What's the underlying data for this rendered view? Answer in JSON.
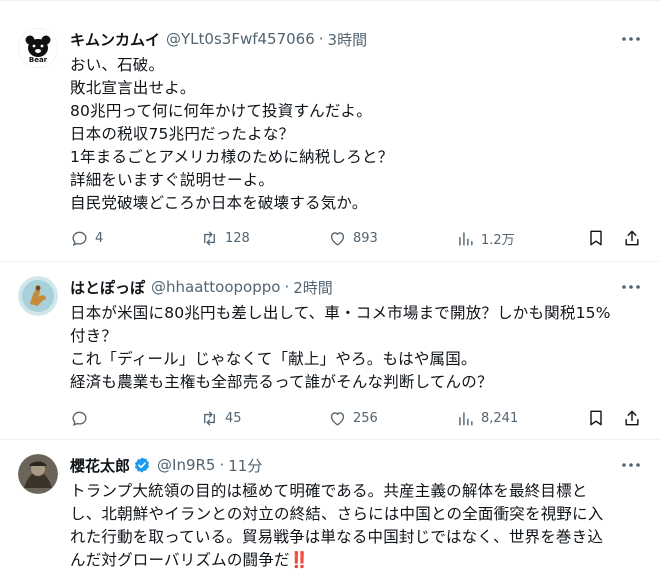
{
  "tweets": [
    {
      "name": "キムンカムイ",
      "handle": "@YLt0s3Fwf457066",
      "dot": "·",
      "time": "3時間",
      "avatar_text": "Bear",
      "text": "おい、石破。\n敗北宣言出せよ。\n80兆円って何に何年かけて投資すんだよ。\n日本の税収75兆円だったよな？\n1年まるごとアメリカ様のために納税しろと？\n詳細をいますぐ説明せーよ。\n自民党破壊どころか日本を破壊する気か。",
      "replies": "4",
      "retweets": "128",
      "likes": "893",
      "views": "1.2万"
    },
    {
      "name": "はとぽっぽ",
      "handle": "@hhaattoopoppo",
      "dot": "·",
      "time": "2時間",
      "text": "日本が米国に80兆円も差し出して、車・コメ市場まで開放？しかも関税15%\n付き？\nこれ「ディール」じゃなくて「献上」やろ。もはや属国。\n経済も農業も主権も全部売るって誰がそんな判断してんの？",
      "replies": "",
      "retweets": "45",
      "likes": "256",
      "views": "8,241"
    },
    {
      "name": "櫻花太郎",
      "handle": "@In9R5",
      "dot": "·",
      "time": "11分",
      "text": "トランプ大統領の目的は極めて明確である。共産主義の解体を最終目標と\nし、北朝鮮やイランとの対立の終結、さらには中国との全面衝突を視野に入\nれた行動を取っている。貿易戦争は単なる中国封じではなく、世界を巻き込\nんだ対グローバリズムの闘争だ‼️"
    }
  ],
  "colors": {
    "secondary": "#536471",
    "verified": "#1d9bf0",
    "border": "#eff3f4"
  }
}
